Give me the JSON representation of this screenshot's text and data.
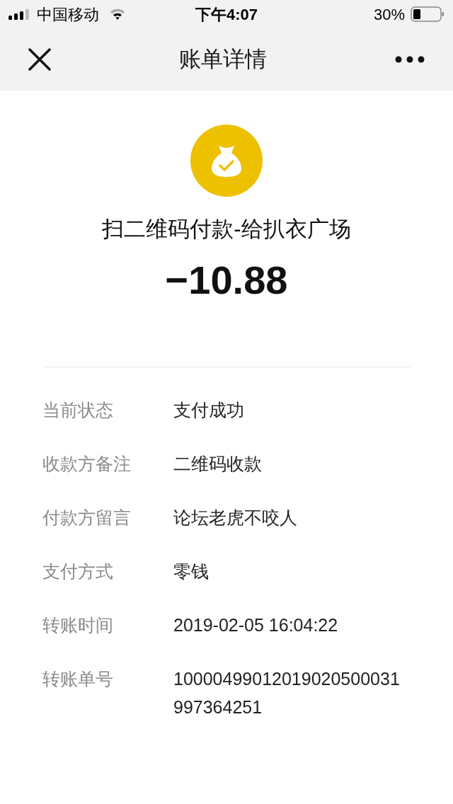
{
  "status_bar": {
    "carrier": "中国移动",
    "time": "下午4:07",
    "battery": "30%"
  },
  "nav": {
    "title": "账单详情"
  },
  "summary": {
    "title": "扫二维码付款-给扒衣广场",
    "amount": "−10.88"
  },
  "details": [
    {
      "label": "当前状态",
      "value": "支付成功"
    },
    {
      "label": "收款方备注",
      "value": "二维码收款"
    },
    {
      "label": "付款方留言",
      "value": "论坛老虎不咬人"
    },
    {
      "label": "支付方式",
      "value": "零钱"
    },
    {
      "label": "转账时间",
      "value": "2019-02-05 16:04:22"
    },
    {
      "label": "转账单号",
      "value": "10000499012019020500031997364251"
    }
  ]
}
